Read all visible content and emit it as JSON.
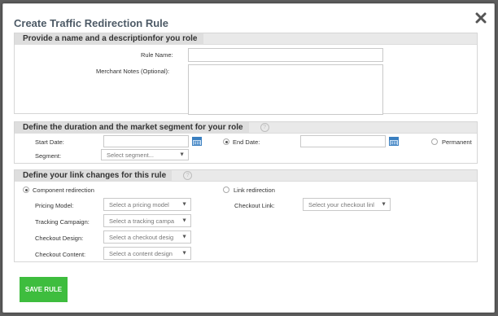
{
  "dialog": {
    "title": "Create Traffic Redirection Rule"
  },
  "section1": {
    "title": "Provide a name and a descriptionfor you role",
    "rule_name_label": "Rule Name:",
    "merchant_notes_label": "Merchant Notes (Optional):"
  },
  "section2": {
    "title": "Define the duration and the market segment for your role",
    "start_date_label": "Start Date:",
    "end_date_label": "End Date:",
    "permanent_label": "Permanent",
    "segment_label": "Segment:",
    "segment_placeholder": "Select segment..."
  },
  "section3": {
    "title": "Define your link changes for this rule",
    "component_redirection_label": "Component redirection",
    "link_redirection_label": "Link redirection",
    "pricing_model_label": "Pricing Model:",
    "pricing_model_value": "Select a pricing model",
    "tracking_campaign_label": "Tracking Campaign:",
    "tracking_campaign_value": "Select a tracking campa",
    "checkout_design_label": "Checkout Design:",
    "checkout_design_value": "Select a checkout desig",
    "checkout_content_label": "Checkout Content:",
    "checkout_content_value": "Select a content design",
    "checkout_link_label": "Checkout Link:",
    "checkout_link_value": "Select your checkout linl"
  },
  "buttons": {
    "save_label": "SAVE RULE"
  },
  "icons": {
    "close": "close-icon",
    "help": "help-icon",
    "calendar": "calendar-icon",
    "dropdown": "chevron-down-icon"
  },
  "colors": {
    "accent_green": "#3ebd3e",
    "calendar_blue": "#3a7fc0",
    "title_color": "#4d5a66"
  }
}
